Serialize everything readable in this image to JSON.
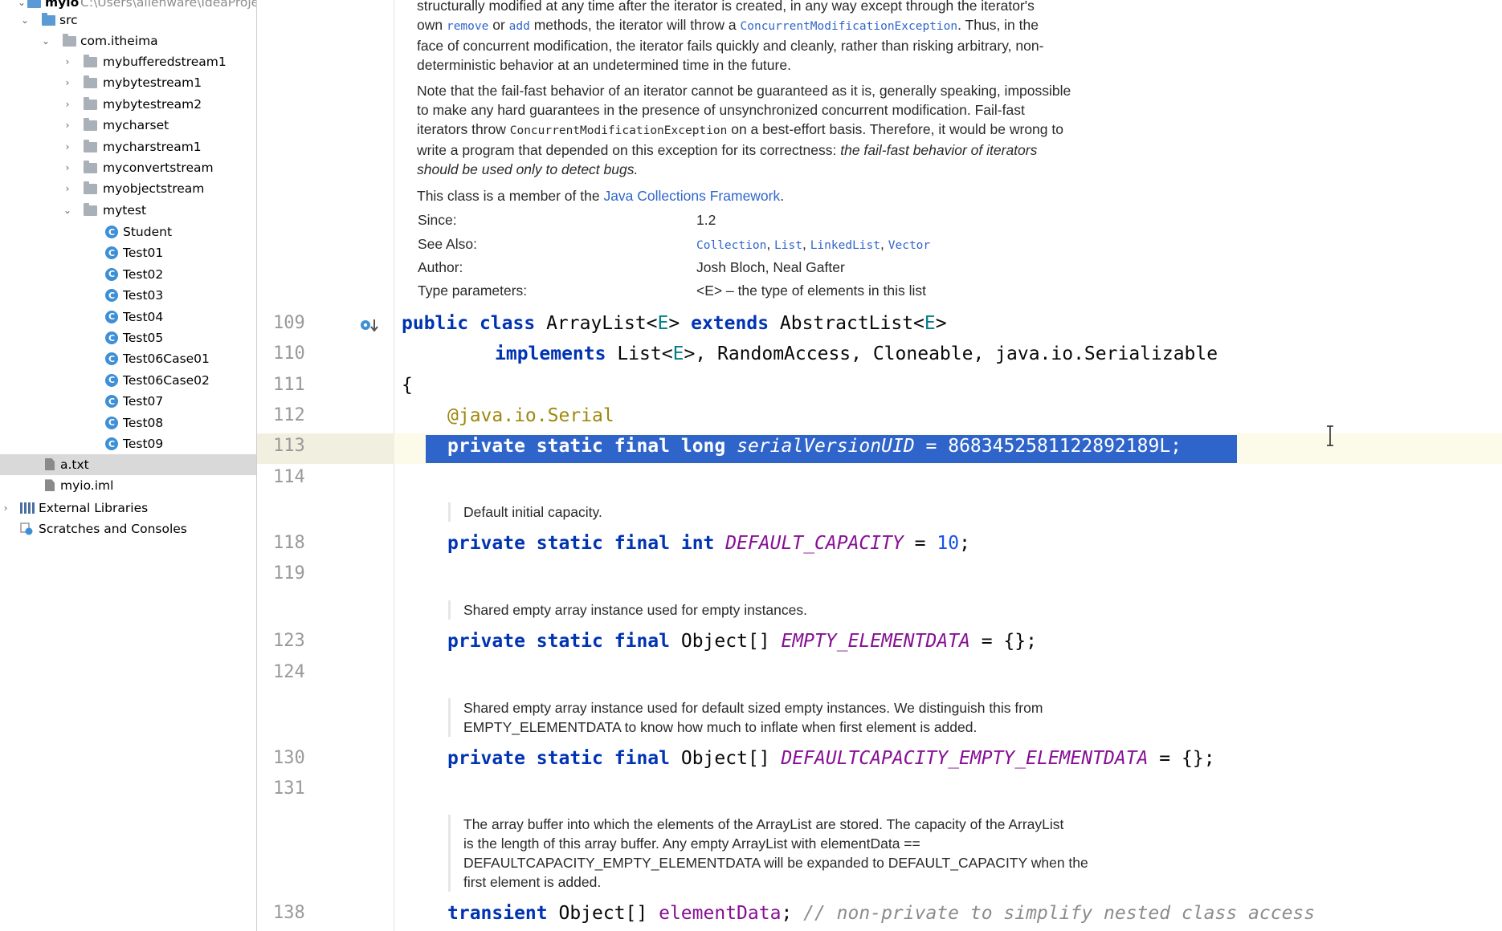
{
  "tree": {
    "project_label": "myio",
    "project_path": "C:\\Users\\alienware\\IdeaProje",
    "src_label": "src",
    "package_label": "com.itheima",
    "folders": [
      "mybufferedstream1",
      "mybytestream1",
      "mybytestream2",
      "mycharset",
      "mycharstream1",
      "myconvertstream",
      "myobjectstream",
      "mytest"
    ],
    "classes": [
      "Student",
      "Test01",
      "Test02",
      "Test03",
      "Test04",
      "Test05",
      "Test06Case01",
      "Test06Case02",
      "Test07",
      "Test08",
      "Test09"
    ],
    "files": [
      "a.txt",
      "myio.iml"
    ],
    "external_libraries": "External Libraries",
    "scratches": "Scratches and Consoles",
    "selected": "a.txt",
    "class_icon_letter": "C"
  },
  "doc_top": {
    "p1": {
      "line1": "structurally modified at any time after the iterator is created, in any way except through the iterator's",
      "line2_a": "own ",
      "remove": "remove",
      "line2_b": " or ",
      "add": "add",
      "line2_c": " methods, the iterator will throw a ",
      "cme": "ConcurrentModificationException",
      "line2_d": ". Thus, in the",
      "line3": "face of concurrent modification, the iterator fails quickly and cleanly, rather than risking arbitrary, non-",
      "line4": "deterministic behavior at an undetermined time in the future."
    },
    "p2": {
      "line1": "Note that the fail-fast behavior of an iterator cannot be guaranteed as it is, generally speaking, impossible",
      "line2": "to make any hard guarantees in the presence of unsynchronized concurrent modification. Fail-fast",
      "line3_a": "iterators throw ",
      "cme": "ConcurrentModificationException",
      "line3_b": " on a best-effort basis. Therefore, it would be wrong to",
      "line4_a": "write a program that depended on this exception for its correctness: ",
      "line4_em": "the fail-fast behavior of iterators",
      "line5_em": "should be used only to detect bugs."
    },
    "p3_a": "This class is a member of the ",
    "p3_link": "Java Collections Framework",
    "p3_b": ".",
    "since_label": "Since:",
    "since_value": "1.2",
    "see_also_label": "See Also:",
    "see_also": [
      "Collection",
      "List",
      "LinkedList",
      "Vector"
    ],
    "see_sep": ", ",
    "author_label": "Author:",
    "author_value": "Josh Bloch, Neal Gafter",
    "type_params_label": "Type parameters:",
    "type_params_value": "<E> – the type of elements in this list"
  },
  "code": {
    "line_numbers": [
      "109",
      "110",
      "111",
      "112",
      "113",
      "114",
      "118",
      "119",
      "123",
      "124",
      "130",
      "131",
      "138"
    ],
    "l109": {
      "public": "public",
      "class": "class",
      "name": "ArrayList<",
      "E": "E",
      "gt": "> ",
      "extends": "extends",
      "super": " AbstractList<",
      "E2": "E",
      "end": ">"
    },
    "l110": {
      "implements": "implements",
      "a": " List<",
      "E": "E",
      "b": ">, RandomAccess, Cloneable, java.io.Serializable"
    },
    "l111": "{",
    "l112": {
      "at": "@java.io.",
      "serial": "Serial"
    },
    "l113": {
      "private": "private",
      "static": "static",
      "final": "final",
      "long": "long",
      "field": "serialVersionUID",
      "eq": " = ",
      "val": "8683452581122892189L",
      "semi": ";"
    },
    "doc_default_capacity": "Default initial capacity.",
    "l118": {
      "private": "private",
      "static": "static",
      "final": "final",
      "int": "int",
      "field": "DEFAULT_CAPACITY",
      "eq": " = ",
      "val": "10",
      "semi": ";"
    },
    "doc_empty": "Shared empty array instance used for empty instances.",
    "l123": {
      "private": "private",
      "static": "static",
      "final": "final",
      "type": "Object[] ",
      "field": "EMPTY_ELEMENTDATA",
      "rest": " = {};"
    },
    "doc_default_empty_1": "Shared empty array instance used for default sized empty instances. We distinguish this from",
    "doc_default_empty_2": "EMPTY_ELEMENTDATA to know how much to inflate when first element is added.",
    "l130": {
      "private": "private",
      "static": "static",
      "final": "final",
      "type": "Object[] ",
      "field": "DEFAULTCAPACITY_EMPTY_ELEMENTDATA",
      "rest": " = {};"
    },
    "doc_buffer_1": "The array buffer into which the elements of the ArrayList are stored. The capacity of the ArrayList",
    "doc_buffer_2": "is the length of this array buffer. Any empty ArrayList with elementData ==",
    "doc_buffer_3": "DEFAULTCAPACITY_EMPTY_ELEMENTDATA will be expanded to DEFAULT_CAPACITY when the",
    "doc_buffer_4": "first element is added.",
    "l138": {
      "transient": "transient",
      "type": " Object[] ",
      "field": "elementData",
      "semi": "; ",
      "comment": "// non-private to simplify nested class access"
    }
  },
  "colors": {
    "keyword": "#0033b3",
    "field": "#871094",
    "number": "#1750eb",
    "annotation": "#9e880d",
    "type_param": "#007e8a",
    "comment": "#8c8c8c",
    "link": "#2f65ca",
    "selection": "#2f65ca",
    "tree_selected": "#d9d9d9"
  },
  "icons": {
    "expanded": "chevron-down-icon",
    "collapsed": "chevron-right-icon",
    "folder": "folder-icon",
    "class": "class-icon",
    "file": "file-icon",
    "libraries": "libraries-icon",
    "scratches": "scratches-icon",
    "gutter": "implements-marker-icon",
    "cursor": "text-cursor-icon"
  }
}
